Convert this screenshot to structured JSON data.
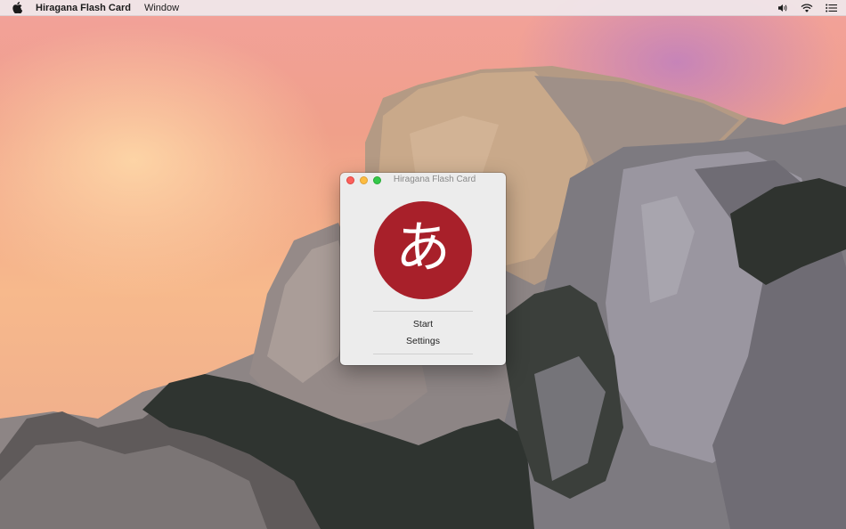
{
  "menubar": {
    "app_name": "Hiragana Flash Card",
    "items": [
      "Window"
    ],
    "icons": [
      "apple-icon",
      "volume-icon",
      "wifi-icon",
      "notification-center-icon"
    ]
  },
  "window": {
    "title": "Hiragana Flash Card",
    "logo_character": "あ",
    "logo_color": "#a8202a",
    "buttons": {
      "start": "Start",
      "settings": "Settings"
    },
    "traffic_lights": {
      "close": "#fc605c",
      "minimize": "#fdbc40",
      "zoom": "#34c84a"
    }
  }
}
